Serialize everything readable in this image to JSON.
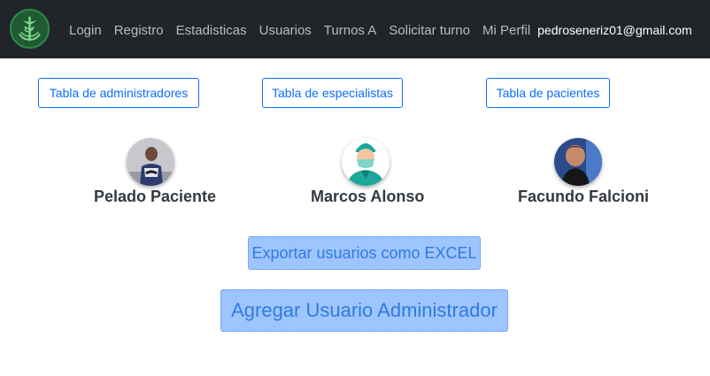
{
  "navbar": {
    "logo_icon": "medical-caduceus-logo",
    "links": [
      "Login",
      "Registro",
      "Estadisticas",
      "Usuarios",
      "Turnos A",
      "Solicitar turno",
      "Mi Perfil"
    ],
    "user_email": "pedroseneriz01@gmail.com"
  },
  "tables": {
    "admins_label": "Tabla de administradores",
    "specialists_label": "Tabla de especialistas",
    "patients_label": "Tabla de pacientes"
  },
  "users": [
    {
      "name": "Pelado Paciente",
      "avatar": "photo-avatar"
    },
    {
      "name": "Marcos Alonso",
      "avatar": "surgeon-avatar"
    },
    {
      "name": "Facundo Falcioni",
      "avatar": "photo-avatar"
    }
  ],
  "actions": {
    "export_label": "Exportar usuarios como EXCEL",
    "add_admin_label": "Agregar Usuario Administrador"
  },
  "colors": {
    "navbar_bg": "#212529",
    "primary": "#0d6efd",
    "button_fill": "#9ec5fe"
  }
}
